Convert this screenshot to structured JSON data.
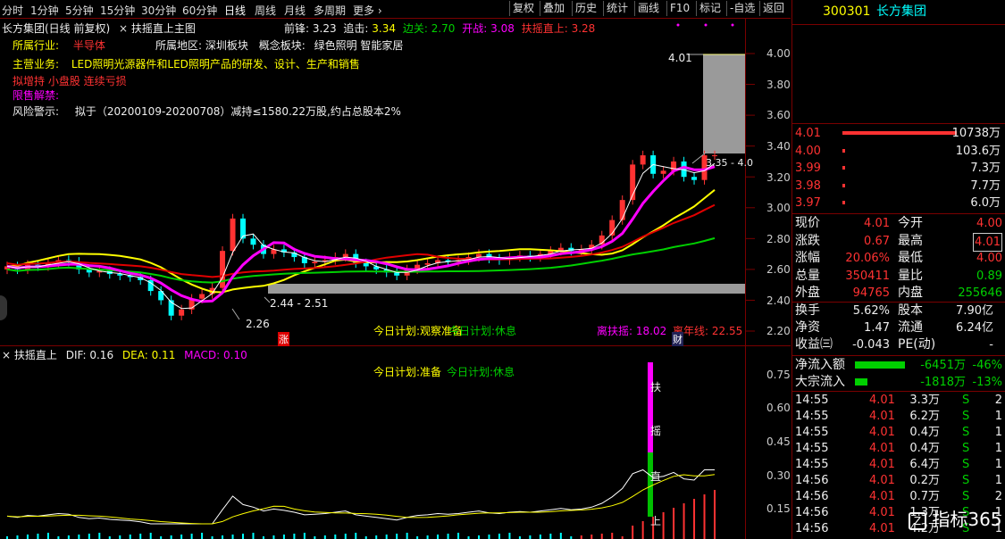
{
  "period_bar": {
    "items": [
      "分时",
      "1分钟",
      "5分钟",
      "15分钟",
      "30分钟",
      "60分钟",
      "日线",
      "周线",
      "月线",
      "多周期",
      "更多"
    ],
    "active": "日线",
    "tools": [
      "复权",
      "叠加",
      "历史",
      "统计",
      "画线",
      "F10",
      "标记",
      "-自选",
      "返回"
    ]
  },
  "chart_header": {
    "stock_title": "长方集团(日线 前复权)",
    "indicator": "扶摇直上主图",
    "qian_label": "前锋:",
    "qian_value": "3.23",
    "zhui_label": "追击:",
    "zhui_value": "3.34",
    "bian_label": "边关:",
    "bian_value": "2.70",
    "kai_label": "开战:",
    "kai_value": "3.08",
    "fu_label": "扶摇直上:",
    "fu_value": "3.28"
  },
  "info": {
    "industry_label": "所属行业:",
    "industry_value": "半导体",
    "region_label": "所属地区:",
    "region_value": "深圳板块",
    "concept_label": "概念板块:",
    "concept_value": "绿色照明 智能家居",
    "business_label": "主营业务:",
    "business_value": "LED照明光源器件和LED照明产品的研发、设计、生产和销售",
    "plan_line": "拟增持 小盘股 连续亏损",
    "restrict_label": "限售解禁:",
    "risk_label": "风险警示:",
    "risk_value": "拟于（20200109-20200708）减持≤1580.22万股,约占总股本2%"
  },
  "chart_labels": {
    "price_top": "4.01",
    "price_right": "3.35 - 4.0",
    "range_label": "2.44 - 2.51",
    "low_label": "2.26",
    "plan_today": "今日计划:观察准备",
    "plan_today2": "今日计划:休息",
    "li_fu_label": "离扶摇:",
    "li_fu_value": "18.02",
    "li_nian_label": "离年线:",
    "li_nian_value": "22.55",
    "zhang_mark": "涨",
    "cai_mark": "财"
  },
  "main_axis": [
    "4.00",
    "3.80",
    "3.60",
    "3.40",
    "3.20",
    "3.00",
    "2.80",
    "2.60",
    "2.40",
    "2.20"
  ],
  "macd": {
    "title": "扶摇直上",
    "dif_label": "DIF:",
    "dif_value": "0.16",
    "dea_label": "DEA:",
    "dea_value": "0.11",
    "macd_label": "MACD:",
    "macd_value": "0.10",
    "plan1": "今日计划:准备",
    "plan2": "今日计划:休息",
    "bar_text": [
      "扶",
      "摇",
      "直",
      "上"
    ],
    "axis": [
      "0.75",
      "0.60",
      "0.45",
      "0.30",
      "0.15"
    ]
  },
  "right_panel": {
    "code": "300301",
    "name": "长方集团",
    "orders": [
      {
        "price": "4.01",
        "vol": "10738万"
      },
      {
        "price": "4.00",
        "vol": "103.6万"
      },
      {
        "price": "3.99",
        "vol": "7.3万"
      },
      {
        "price": "3.98",
        "vol": "7.7万"
      },
      {
        "price": "3.97",
        "vol": "6.0万"
      }
    ],
    "stats": [
      {
        "l1": "现价",
        "v1": "4.01",
        "l2": "今开",
        "v2": "4.00"
      },
      {
        "l1": "涨跌",
        "v1": "0.67",
        "l2": "最高",
        "v2": "4.01"
      },
      {
        "l1": "涨幅",
        "v1": "20.06%",
        "l2": "最低",
        "v2": "4.00"
      },
      {
        "l1": "总量",
        "v1": "350411",
        "l2": "量比",
        "v2": "0.89"
      },
      {
        "l1": "外盘",
        "v1": "94765",
        "l2": "内盘",
        "v2": "255646"
      }
    ],
    "stats2": [
      {
        "l1": "换手",
        "v1": "5.62%",
        "l2": "股本",
        "v2": "7.90亿"
      },
      {
        "l1": "净资",
        "v1": "1.47",
        "l2": "流通",
        "v2": "6.24亿"
      },
      {
        "l1": "收益㈢",
        "v1": "-0.043",
        "l2": "PE(动)",
        "v2": "-"
      }
    ],
    "flows": [
      {
        "label": "净流入额",
        "value": "-6451万",
        "pct": "-46%"
      },
      {
        "label": "大宗流入",
        "value": "-1818万",
        "pct": "-13%"
      }
    ],
    "ticks": [
      {
        "time": "14:55",
        "price": "4.01",
        "vol": "3.3万",
        "side": "S",
        "n": "2"
      },
      {
        "time": "14:55",
        "price": "4.01",
        "vol": "6.2万",
        "side": "S",
        "n": "1"
      },
      {
        "time": "14:55",
        "price": "4.01",
        "vol": "0.4万",
        "side": "S",
        "n": "1"
      },
      {
        "time": "14:55",
        "price": "4.01",
        "vol": "0.4万",
        "side": "S",
        "n": "1"
      },
      {
        "time": "14:55",
        "price": "4.01",
        "vol": "6.4万",
        "side": "S",
        "n": "1"
      },
      {
        "time": "14:56",
        "price": "4.01",
        "vol": "0.2万",
        "side": "S",
        "n": "1"
      },
      {
        "time": "14:56",
        "price": "4.01",
        "vol": "0.7万",
        "side": "S",
        "n": "2"
      },
      {
        "time": "14:56",
        "price": "4.01",
        "vol": "1.3万",
        "side": "S",
        "n": "1"
      },
      {
        "time": "14:56",
        "price": "4.01",
        "vol": "4.2万",
        "side": "S",
        "n": "1"
      }
    ],
    "watermark": "指标365"
  },
  "colors": {
    "up": "#ff3232",
    "down": "#00ffff",
    "ma_yellow": "#ffff00",
    "ma_red": "#e00000",
    "ma_green": "#00d000",
    "ma_magenta": "#ff00ff"
  }
}
